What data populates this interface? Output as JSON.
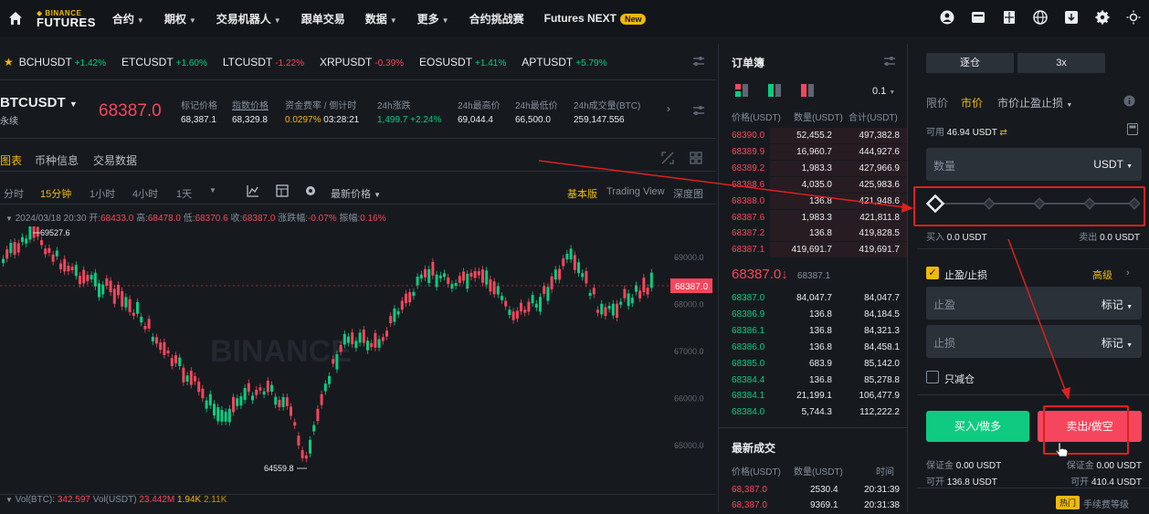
{
  "nav": {
    "brand_top": "BINANCE",
    "brand_bottom": "FUTURES",
    "items": [
      {
        "label": "合约",
        "caret": true
      },
      {
        "label": "期权",
        "caret": true
      },
      {
        "label": "交易机器人",
        "caret": true
      },
      {
        "label": "跟单交易",
        "caret": false
      },
      {
        "label": "数据",
        "caret": true
      },
      {
        "label": "更多",
        "caret": true
      },
      {
        "label": "合约挑战赛",
        "caret": false
      },
      {
        "label": "Futures NEXT",
        "caret": false
      }
    ],
    "new_badge": "New"
  },
  "ticker": [
    {
      "symbol": "BCHUSDT",
      "change": "+1.42%",
      "dir": "up"
    },
    {
      "symbol": "ETCUSDT",
      "change": "+1.60%",
      "dir": "up"
    },
    {
      "symbol": "LTCUSDT",
      "change": "-1.22%",
      "dir": "dn"
    },
    {
      "symbol": "XRPUSDT",
      "change": "-0.39%",
      "dir": "dn"
    },
    {
      "symbol": "EOSUSDT",
      "change": "+1.41%",
      "dir": "up"
    },
    {
      "symbol": "APTUSDT",
      "change": "+5.79%",
      "dir": "up"
    }
  ],
  "symbol": {
    "name": "BTCUSDT",
    "sub": "永续",
    "last_price": "68387.0",
    "stats": [
      {
        "label": "标记价格",
        "value": "68,387.1",
        "cls": ""
      },
      {
        "label": "指数价格",
        "value": "68,329.8",
        "cls": ""
      },
      {
        "label": "资金费率 / 倒计时",
        "value": "0.0297%",
        "value2": "03:28:21",
        "cls": "gold"
      },
      {
        "label": "24h涨跌",
        "value": "1,499.7 +2.24%",
        "cls": "up"
      },
      {
        "label": "24h最高价",
        "value": "69,044.4",
        "cls": ""
      },
      {
        "label": "24h最低价",
        "value": "66,500.0",
        "cls": ""
      },
      {
        "label": "24h成交量(BTC)",
        "value": "259,147.556",
        "cls": ""
      }
    ]
  },
  "chart_tabs": [
    "图表",
    "币种信息",
    "交易数据"
  ],
  "timeframes": [
    "分时",
    "15分钟",
    "1小时",
    "4小时",
    "1天"
  ],
  "price_type": "最新价格",
  "views": [
    "基本版",
    "Trading View",
    "深度图"
  ],
  "ohlc": {
    "date": "2024/03/18 20:30",
    "open_label": "开:",
    "open": "68433.0",
    "high_label": "高:",
    "high": "68478.0",
    "low_label": "低:",
    "low": "68370.6",
    "close_label": "收:",
    "close": "68387.0",
    "chg_label": "涨跌幅:",
    "chg": "-0.07%",
    "amp_label": "振幅:",
    "amp": "0.16%"
  },
  "chart": {
    "watermark": "BINANCE",
    "price_tag": "68387.0",
    "high_mark": "69527.6",
    "low_mark": "64559.8",
    "axis": [
      "69000.0",
      "68000.0",
      "67000.0",
      "66000.0",
      "65000.0"
    ]
  },
  "vol": {
    "a_label": "Vol(BTC):",
    "a_val": "342.597",
    "b_label": "Vol(USDT)",
    "b_val": "23.442M",
    "c_val": "1.94K",
    "d_val": "2.11K"
  },
  "orderbook": {
    "title": "订单簿",
    "precision": "0.1",
    "headers": [
      "价格(USDT)",
      "数量(USDT)",
      "合计(USDT)"
    ],
    "asks": [
      [
        "68390.0",
        "52,455.2",
        "497,382.8"
      ],
      [
        "68389.9",
        "16,960.7",
        "444,927.6"
      ],
      [
        "68389.2",
        "1,983.3",
        "427,966.9"
      ],
      [
        "68388.6",
        "4,035.0",
        "425,983.6"
      ],
      [
        "68388.0",
        "136.8",
        "421,948.6"
      ],
      [
        "68387.6",
        "1,983.3",
        "421,811.8"
      ],
      [
        "68387.2",
        "136.8",
        "419,828.5"
      ],
      [
        "68387.1",
        "419,691.7",
        "419,691.7"
      ]
    ],
    "mid_price": "68387.0",
    "mid_arrow": "↓",
    "mid_mark": "68387.1",
    "bids": [
      [
        "68387.0",
        "84,047.7",
        "84,047.7"
      ],
      [
        "68386.9",
        "136.8",
        "84,184.5"
      ],
      [
        "68386.1",
        "136.8",
        "84,321.3"
      ],
      [
        "68386.0",
        "136.8",
        "84,458.1"
      ],
      [
        "68385.0",
        "683.9",
        "85,142.0"
      ],
      [
        "68384.4",
        "136.8",
        "85,278.8"
      ],
      [
        "68384.1",
        "21,199.1",
        "106,477.9"
      ],
      [
        "68384.0",
        "5,744.3",
        "112,222.2"
      ]
    ],
    "trades_title": "最新成交",
    "trade_headers": [
      "价格(USDT)",
      "数量(USDT)",
      "时间"
    ],
    "trades": [
      [
        "68,387.0",
        "2530.4",
        "20:31:39"
      ],
      [
        "68,387.0",
        "9369.1",
        "20:31:38"
      ]
    ]
  },
  "trade": {
    "margin_mode": "逐仓",
    "leverage": "3x",
    "order_types": [
      "限价",
      "市价",
      "市价止盈止损"
    ],
    "avail_label": "可用",
    "avail_value": "46.94 USDT",
    "qty_placeholder": "数量",
    "qty_unit": "USDT",
    "buy_amt_label": "买入",
    "buy_amt": "0.0 USDT",
    "sell_amt_label": "卖出",
    "sell_amt": "0.0 USDT",
    "slider_pct": 0,
    "tpsl_label": "止盈/止损",
    "tpsl_checked": true,
    "advanced": "高级",
    "tp_label": "止盈",
    "sl_label": "止损",
    "mark_label": "标记",
    "reduce_only": "只减仓",
    "buy_btn": "买入/做多",
    "sell_btn": "卖出/做空",
    "margin_label": "保证金",
    "buy_margin": "0.00 USDT",
    "sell_margin": "0.00 USDT",
    "open_label": "可开",
    "buy_open": "136.8 USDT",
    "sell_open": "410.4 USDT",
    "hot": "热门",
    "fee_tier": "手续费等级"
  }
}
